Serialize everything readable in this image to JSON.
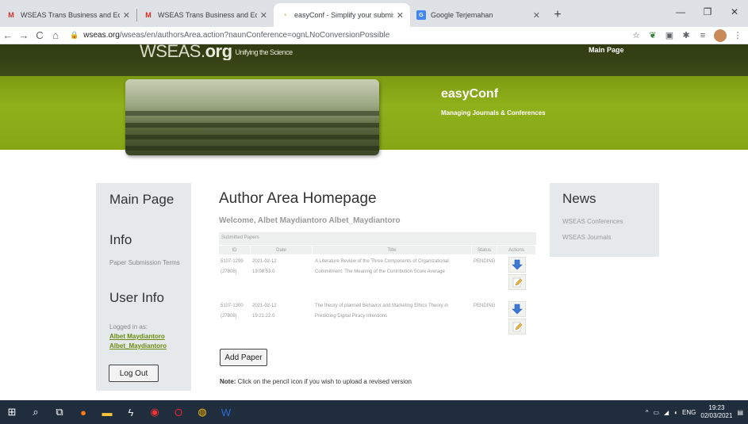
{
  "browser": {
    "tabs": [
      {
        "title": "WSEAS Trans Business and Econ",
        "favicon": "gmail-icon",
        "active": false
      },
      {
        "title": "WSEAS Trans Business and Econ",
        "favicon": "gmail-icon",
        "active": false
      },
      {
        "title": "easyConf - Simplify your submiss",
        "favicon": "easyconf-icon",
        "active": true
      },
      {
        "title": "Google Terjemahan",
        "favicon": "google-translate-icon",
        "active": false
      }
    ],
    "new_tab": "+",
    "url_host": "wseas.org",
    "url_path": "/wseas/en/authorsArea.action?naunConference=ognLNoConversionPossible"
  },
  "site": {
    "logo_main": "WSEAS.",
    "logo_org": "org",
    "tagline": "Unifying the Science",
    "top_link": "Main Page",
    "brand_title": "easyConf",
    "brand_subtitle": "Managing Journals & Conferences"
  },
  "left_panel": {
    "main_heading": "Main Page",
    "info_heading": "Info",
    "info_link": "Paper Submission Terms",
    "user_heading": "User Info",
    "logged_in_label": "Logged in as:",
    "user_name": "Albet Maydiantoro",
    "user_login": "Albet_Maydiantoro",
    "logout_label": "Log Out"
  },
  "main": {
    "title": "Author Area Homepage",
    "welcome": "Welcome, Albet Maydiantoro Albet_Maydiantoro",
    "table_caption": "Submitted Papers",
    "columns": [
      "ID",
      "Date",
      "Title",
      "Status",
      "Actions"
    ],
    "rows": [
      {
        "id_line1": "5107-1299",
        "id_line2": "(27808)",
        "date_line1": "2021-02-12",
        "date_line2": "19:08:53.0",
        "title": "A Literature Review of the Three Components of Organizational Commitment: The Meaning of the Contribution Score Average",
        "status": "PENDING"
      },
      {
        "id_line1": "5107-1300",
        "id_line2": "(27808)",
        "date_line1": "2021-02-12",
        "date_line2": "19:21:22.0",
        "title": "The theory of planned Behavior and Marketing Ethics Theory in Predicting Digital Piracy Intentions",
        "status": "PENDING"
      }
    ],
    "add_paper_label": "Add Paper",
    "note_bold": "Note:",
    "note_text": " Click on the pencil icon if you wish to upload a revised version"
  },
  "news": {
    "heading": "News",
    "links": [
      "WSEAS Conferences",
      "WSEAS Journals"
    ]
  },
  "taskbar": {
    "lang": "ENG",
    "time": "19:23",
    "date": "02/03/2021"
  }
}
